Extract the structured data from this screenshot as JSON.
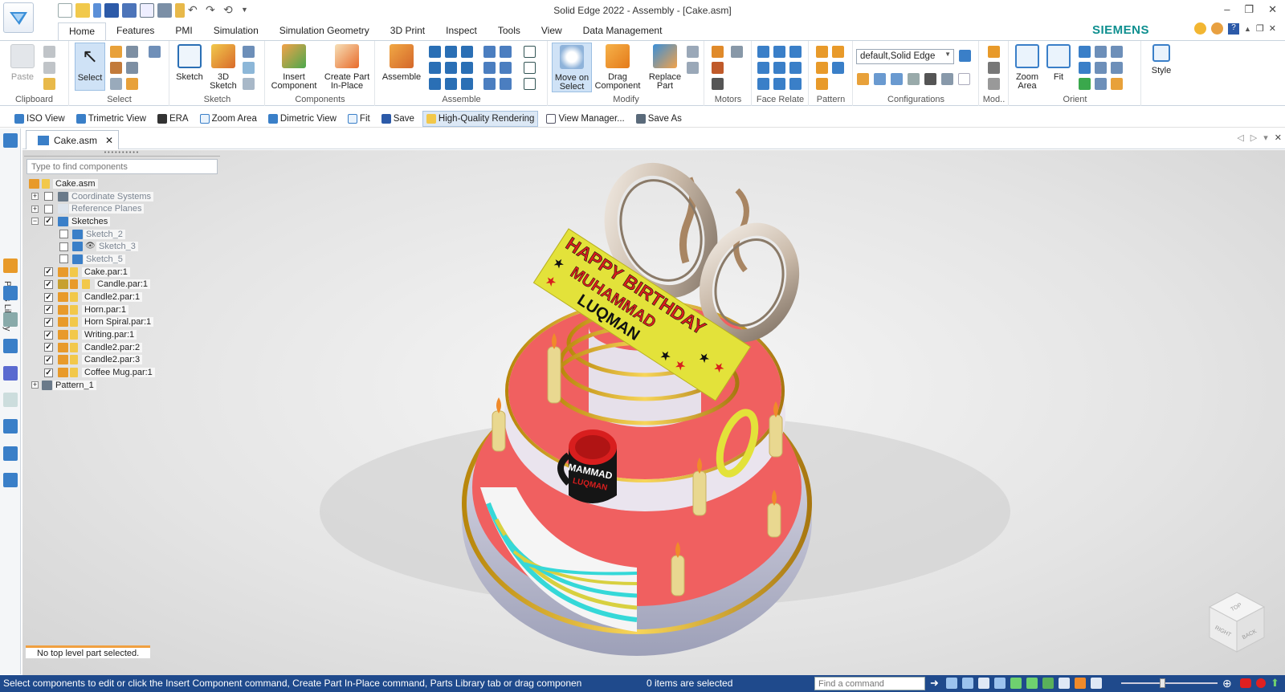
{
  "window": {
    "title": "Solid Edge 2022 - Assembly - [Cake.asm]",
    "brand": "SIEMENS",
    "brand_color": "#0e8f8f",
    "controls": [
      "–",
      "❐",
      "✕"
    ]
  },
  "ribbon": {
    "tabs": [
      "Home",
      "Features",
      "PMI",
      "Simulation",
      "Simulation Geometry",
      "3D Print",
      "Inspect",
      "Tools",
      "View",
      "Data Management"
    ],
    "active_tab": "Home",
    "groups": {
      "clipboard": {
        "label": "Clipboard",
        "paste": "Paste"
      },
      "select": {
        "label": "Select",
        "select": "Select"
      },
      "sketch": {
        "label": "Sketch",
        "sketch": "Sketch",
        "sketch3d_1": "3D",
        "sketch3d_2": "Sketch"
      },
      "components": {
        "label": "Components",
        "insert_1": "Insert",
        "insert_2": "Component",
        "create_1": "Create Part",
        "create_2": "In-Place"
      },
      "assemble": {
        "label": "Assemble",
        "assemble": "Assemble"
      },
      "modify": {
        "label": "Modify",
        "move_1": "Move on",
        "move_2": "Select",
        "drag_1": "Drag",
        "drag_2": "Component",
        "replace_1": "Replace",
        "replace_2": "Part"
      },
      "motors": {
        "label": "Motors"
      },
      "face_relate": {
        "label": "Face Relate"
      },
      "pattern": {
        "label": "Pattern"
      },
      "configurations": {
        "label": "Configurations",
        "dropdown_value": "default,Solid Edge"
      },
      "mod": {
        "label": "Mod.."
      },
      "orient": {
        "label": "Orient",
        "zoom_1": "Zoom",
        "zoom_2": "Area",
        "fit": "Fit"
      },
      "style": {
        "label": "Style"
      }
    }
  },
  "view_toolbar": [
    {
      "label": "ISO View"
    },
    {
      "label": "Trimetric View"
    },
    {
      "label": "ERA"
    },
    {
      "label": "Zoom Area"
    },
    {
      "label": "Dimetric View"
    },
    {
      "label": "Fit"
    },
    {
      "label": "Save"
    },
    {
      "label": "High-Quality Rendering",
      "active": true
    },
    {
      "label": "View Manager..."
    },
    {
      "label": "Save As"
    }
  ],
  "left_panel": {
    "parts_library": "Parts Library"
  },
  "document_tab": {
    "label": "Cake.asm",
    "close": "✕"
  },
  "pathfinder": {
    "search_placeholder": "Type to find components",
    "tree": [
      {
        "label": "Cake.asm",
        "level": 0
      },
      {
        "label": "Coordinate Systems",
        "level": 1,
        "expander": "+",
        "checked": false,
        "greyed": true
      },
      {
        "label": "Reference Planes",
        "level": 1,
        "expander": "+",
        "checked": false,
        "greyed": true
      },
      {
        "label": "Sketches",
        "level": 1,
        "expander": "−",
        "checked": true
      },
      {
        "label": "Sketch_2",
        "level": 2,
        "checked": false,
        "greyed": true
      },
      {
        "label": "Sketch_3",
        "level": 2,
        "checked": false,
        "greyed": true
      },
      {
        "label": "Sketch_5",
        "level": 2,
        "checked": false,
        "greyed": true
      },
      {
        "label": "Cake.par:1",
        "level": 1,
        "checked": true
      },
      {
        "label": "Candle.par:1",
        "level": 1,
        "checked": true
      },
      {
        "label": "Candle2.par:1",
        "level": 1,
        "checked": true
      },
      {
        "label": "Horn.par:1",
        "level": 1,
        "checked": true
      },
      {
        "label": "Horn Spiral.par:1",
        "level": 1,
        "checked": true
      },
      {
        "label": "Writing.par:1",
        "level": 1,
        "checked": true
      },
      {
        "label": "Candle2.par:2",
        "level": 1,
        "checked": true
      },
      {
        "label": "Candle2.par:3",
        "level": 1,
        "checked": true
      },
      {
        "label": "Coffee Mug.par:1",
        "level": 1,
        "checked": true
      },
      {
        "label": "Pattern_1",
        "level": 0,
        "expander": "+"
      }
    ],
    "status": "No top level part selected."
  },
  "model": {
    "banner_line1": "HAPPY BIRTHDAY",
    "banner_line2": "MUHAMMAD",
    "banner_line3": "LUQMAN",
    "mug_text1": "MAMMAD",
    "mug_text2": "LUQMAN",
    "colors": {
      "coral": "#f06060",
      "gold": "#e8b93a",
      "cyan": "#35d8d8",
      "chrome": "#d8cfc4",
      "banner": "#e3e23a",
      "mug": "#1a1a1a"
    }
  },
  "viewcube": {
    "top": "TOP",
    "right": "RIGHT",
    "back": "BACK"
  },
  "statusbar": {
    "message": "Select components to edit or click the Insert Component command, Create Part In-Place command, Parts Library tab or drag componen",
    "selection_count": "0 items are selected",
    "find_placeholder": "Find a command",
    "bg_color": "#1f4a8c"
  }
}
